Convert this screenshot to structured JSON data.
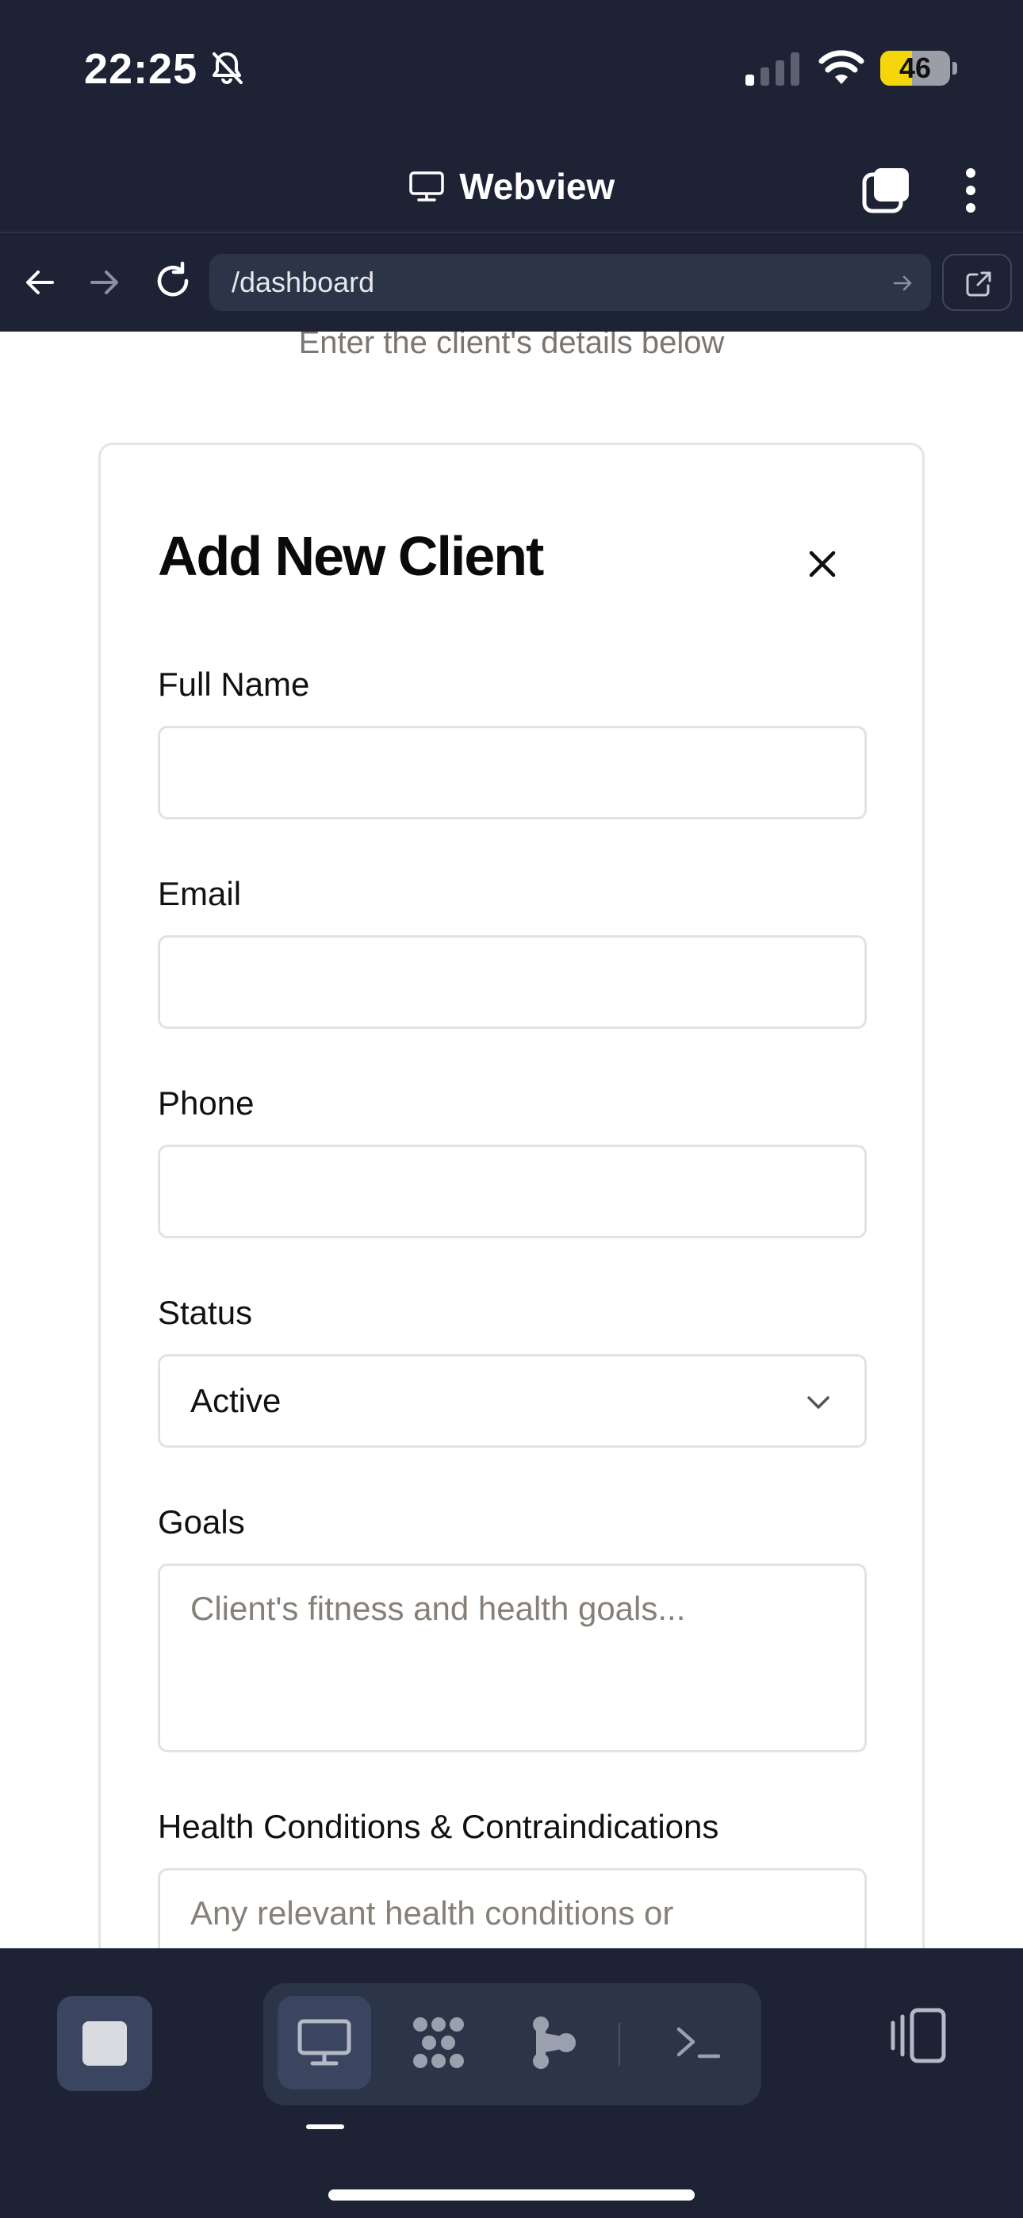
{
  "status_bar": {
    "time": "22:25",
    "battery_level": "46",
    "battery_percent": 46,
    "signal_bars_active": 1,
    "signal_bars_total": 4
  },
  "webview_bar": {
    "title": "Webview",
    "icons": [
      "monitor-icon",
      "tabs-icon",
      "more-vertical-icon"
    ]
  },
  "url_bar": {
    "url": "/dashboard",
    "icons": [
      "back-arrow-icon",
      "forward-arrow-icon",
      "reload-icon",
      "go-arrow-icon",
      "external-link-icon"
    ]
  },
  "page": {
    "subtitle": "Enter the client's details below"
  },
  "form": {
    "title": "Add New Client",
    "full_name": {
      "label": "Full Name",
      "value": ""
    },
    "email": {
      "label": "Email",
      "value": ""
    },
    "phone": {
      "label": "Phone",
      "value": ""
    },
    "status": {
      "label": "Status",
      "value": "Active"
    },
    "goals": {
      "label": "Goals",
      "placeholder": "Client's fitness and health goals..."
    },
    "health": {
      "label": "Health Conditions & Contraindications",
      "placeholder": "Any relevant health conditions or"
    }
  },
  "toolbar": {
    "icons": [
      "stop-icon",
      "desktop-icon",
      "grid-dots-icon",
      "branch-icon",
      "terminal-icon",
      "split-view-icon"
    ],
    "active_mode": "desktop"
  },
  "colors": {
    "chrome_background": "#1d2335",
    "url_field": "#2c3448",
    "battery_fill": "#f5d60a",
    "placeholder_text": "#868079"
  }
}
